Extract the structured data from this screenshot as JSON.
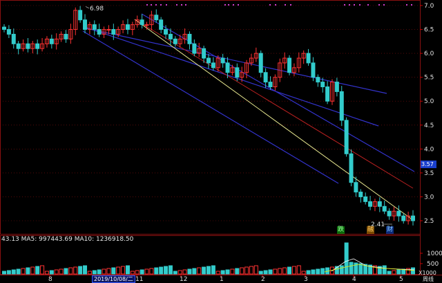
{
  "title_text": "",
  "header": {
    "volume_text": "43.13  MA5: 997443.69  MA10: 1236918.50"
  },
  "price_tag": "3.57",
  "unit_label": "X1000",
  "cursor_date": "2019/10/08/二",
  "corner_label": "周线",
  "event_tags": [
    "跌",
    "融",
    "财"
  ],
  "colors": {
    "background": "#000000",
    "up_candle": "#ff3333",
    "down_candle": "#33cccc",
    "channel": "#3333cc",
    "trend_red": "#b82020",
    "trend_yellow": "#e8e890",
    "grid": "#8a1010"
  },
  "chart_data": [
    {
      "type": "candlestick",
      "title": "",
      "ylim": [
        2.3,
        7.0
      ],
      "y_ticks": [
        "7.0",
        "6.5",
        "6.0",
        "5.5",
        "5.0",
        "4.5",
        "4.0",
        "3.5",
        "3.0",
        "2.5"
      ],
      "x_ticks": [
        "8",
        "11",
        "12",
        "1",
        "2",
        "3",
        "4",
        "5"
      ],
      "annotations": [
        {
          "text": "6.98",
          "value": 6.98
        },
        {
          "text": "2.41",
          "value": 2.41
        }
      ],
      "price_series_approx": [
        6.5,
        6.4,
        6.2,
        6.1,
        6.2,
        6.1,
        6.2,
        6.1,
        6.2,
        6.3,
        6.2,
        6.3,
        6.4,
        6.3,
        6.5,
        6.9,
        6.7,
        6.5,
        6.6,
        6.5,
        6.4,
        6.5,
        6.5,
        6.4,
        6.5,
        6.6,
        6.5,
        6.6,
        6.7,
        6.6,
        6.6,
        6.8,
        6.7,
        6.5,
        6.4,
        6.3,
        6.2,
        6.3,
        6.4,
        6.2,
        6.0,
        6.1,
        5.9,
        5.8,
        5.7,
        5.9,
        5.8,
        5.6,
        5.7,
        5.5,
        5.6,
        5.8,
        5.9,
        6.0,
        5.6,
        5.4,
        5.3,
        5.5,
        5.8,
        5.9,
        5.6,
        5.7,
        5.9,
        6.0,
        5.8,
        5.5,
        5.4,
        5.3,
        5.0,
        5.4,
        5.2,
        4.6,
        3.9,
        3.3,
        3.1,
        3.0,
        2.9,
        2.8,
        2.9,
        2.8,
        2.7,
        2.6,
        2.7,
        2.6,
        2.5,
        2.6,
        2.5
      ]
    },
    {
      "type": "bar",
      "title": "",
      "series": [
        {
          "name": "MA5",
          "values": [
            997443.69
          ]
        },
        {
          "name": "MA10",
          "values": [
            1236918.5
          ]
        }
      ],
      "y_ticks": [
        "1000",
        "500"
      ],
      "xlabel": "",
      "ylabel": ""
    }
  ]
}
